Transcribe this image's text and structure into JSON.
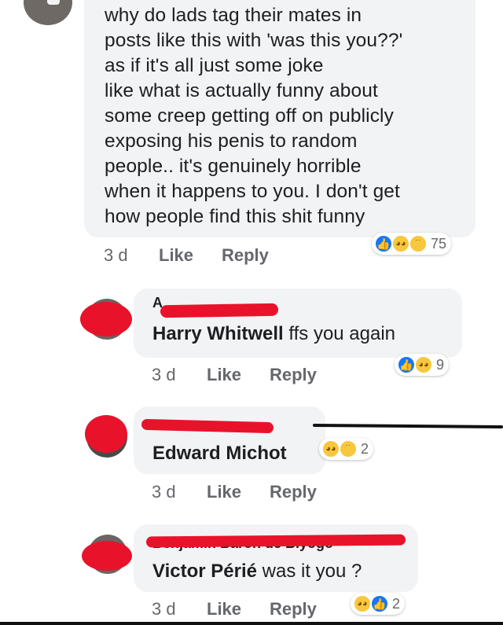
{
  "main_comment": {
    "text": "why do lads tag their mates in\nposts like this with 'was this you??'\nas if it's all just some joke\nlike what is actually funny about\nsome creep getting off on publicly\nexposing his penis to random\npeople.. it's genuinely horrible\nwhen it happens to you. I don't get\nhow people find this shit funny",
    "time": "3 d",
    "like_label": "Like",
    "reply_label": "Reply",
    "reactions": [
      "like",
      "haha",
      "sad"
    ],
    "reaction_count": "75"
  },
  "replies": [
    {
      "author_partial": "A",
      "tagged_name": "Harry Whitwell",
      "text": " ffs you again",
      "time": "3 d",
      "like_label": "Like",
      "reply_label": "Reply",
      "reactions": [
        "like",
        "haha"
      ],
      "reaction_count": "9"
    },
    {
      "tagged_name": "Edward Michot",
      "text": "",
      "time": "3 d",
      "like_label": "Like",
      "reply_label": "Reply",
      "reactions": [
        "haha",
        "sad"
      ],
      "reaction_count": "2"
    },
    {
      "author_partial": "Benjamin Baron de Biyogo",
      "tagged_name": "Victor Périé",
      "text": " was it you ?",
      "time": "3 d",
      "like_label": "Like",
      "reply_label": "Reply",
      "reactions": [
        "haha",
        "like"
      ],
      "reaction_count": "2"
    }
  ],
  "colors": {
    "redaction": "#e8132b",
    "bubble": "#f2f3f5",
    "like_blue": "#1877f2",
    "emoji_yellow": "#f7c73d"
  }
}
